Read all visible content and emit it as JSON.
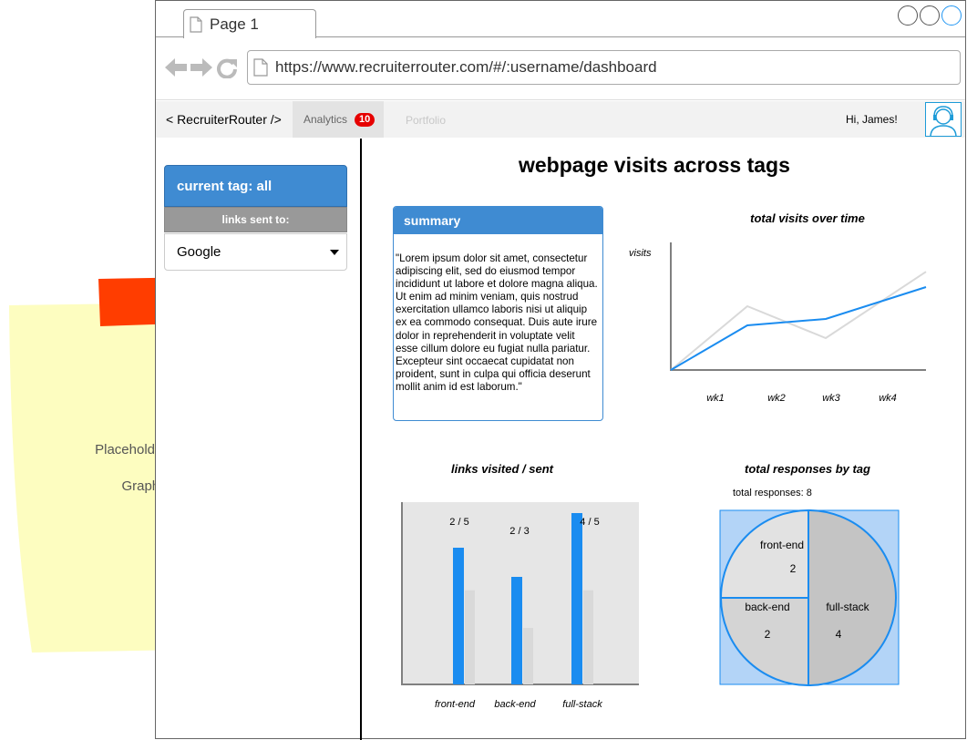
{
  "browser": {
    "tab_title": "Page 1",
    "url": "https://www.recruiterrouter.com/#/:username/dashboard"
  },
  "header": {
    "brand": "< RecruiterRouter />",
    "nav": {
      "analytics_label": "Analytics",
      "analytics_badge": "10",
      "portfolio_label": "Portfolio"
    },
    "greeting": "Hi, James!"
  },
  "sidebar": {
    "current_tag": "current tag: all",
    "links_sent_label": "links sent to:",
    "selected_site": "Google"
  },
  "main": {
    "page_title": "webpage visits across tags",
    "summary": {
      "title": "summary",
      "body": "\"Lorem ipsum dolor sit amet, consectetur adipiscing elit, sed do eiusmod tempor incididunt ut labore et dolore magna aliqua. Ut enim ad minim veniam, quis nostrud exercitation ullamco laboris nisi ut aliquip ex ea commodo consequat. Duis aute irure dolor in reprehenderit in voluptate velit esse cillum dolore eu fugiat nulla pariatur. Excepteur sint occaecat cupidatat non proident, sunt in culpa qui officia deserunt mollit anim id est laborum.\""
    }
  },
  "sticky_note": {
    "line1": "Placeholder analytics",
    "line2": "Graphs TBD"
  },
  "colors": {
    "accent": "#3f8bd2",
    "series_blue": "#1a8cf0",
    "series_gray": "#d9d9d9",
    "badge": "#e60000",
    "sticky": "#fdfdc0",
    "sticky_tape": "#ff3d00",
    "pie_bg": "#b3d4f7"
  },
  "chart_data": [
    {
      "type": "line",
      "title": "total visits over time",
      "ylabel": "visits",
      "xlabel": "",
      "categories": [
        "wk1",
        "wk2",
        "wk3",
        "wk4"
      ],
      "x0_label": "",
      "ylim": [
        0,
        1
      ],
      "series": [
        {
          "values": [
            0,
            0.35,
            0.4,
            0.65
          ],
          "color": "#1a8cf0"
        },
        {
          "values": [
            0,
            0.5,
            0.25,
            0.77
          ],
          "color": "#d9d9d9"
        }
      ]
    },
    {
      "type": "bar",
      "title": "links visited / sent",
      "categories": [
        "front-end",
        "back-end",
        "full-stack"
      ],
      "series": [
        {
          "values": [
            2,
            2,
            4
          ],
          "color": "#1a8cf0"
        },
        {
          "values": [
            5,
            3,
            5
          ],
          "color": "#d9d9d9"
        }
      ],
      "data_labels": [
        "2 / 5",
        "2 / 3",
        "4 / 5"
      ],
      "ylim": [
        0,
        6
      ]
    },
    {
      "type": "pie",
      "title": "total responses by tag",
      "subtitle": "total responses: 8",
      "slices": [
        {
          "label": "full-stack",
          "value": 4
        },
        {
          "label": "back-end",
          "value": 2
        },
        {
          "label": "front-end",
          "value": 2
        }
      ]
    }
  ]
}
